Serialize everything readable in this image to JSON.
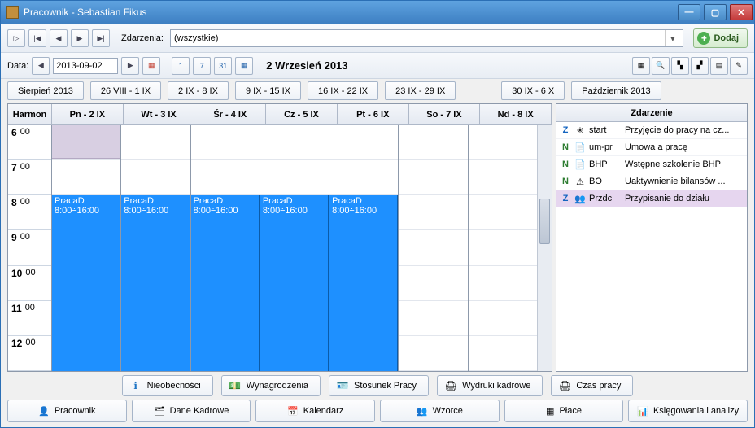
{
  "window": {
    "title": "Pracownik - Sebastian Fikus"
  },
  "toolbar": {
    "events_label": "Zdarzenia:",
    "events_value": "(wszystkie)",
    "add_label": "Dodaj",
    "date_label": "Data:",
    "date_value": "2013-09-02",
    "date_title": "2 Wrzesień 2013"
  },
  "nav_tabs": {
    "prev_month": "Sierpień 2013",
    "w1": "26 VIII - 1 IX",
    "w2": "2 IX - 8 IX",
    "w3": "9 IX - 15 IX",
    "w4": "16 IX - 22 IX",
    "w5": "23 IX - 29 IX",
    "w6": "30 IX - 6 X",
    "next_month": "Październik 2013"
  },
  "calendar": {
    "harmon_label": "Harmon",
    "days": [
      "Pn - 2 IX",
      "Wt - 3 IX",
      "Śr - 4 IX",
      "Cz - 5 IX",
      "Pt - 6 IX",
      "So - 7 IX",
      "Nd - 8 IX"
    ],
    "hours": [
      {
        "h": "6",
        "m": "00"
      },
      {
        "h": "7",
        "m": "00"
      },
      {
        "h": "8",
        "m": "00"
      },
      {
        "h": "9",
        "m": "00"
      },
      {
        "h": "10",
        "m": "00"
      },
      {
        "h": "11",
        "m": "00"
      },
      {
        "h": "12",
        "m": "00"
      }
    ],
    "event_title": "PracaD",
    "event_time": "8:00÷16:00"
  },
  "side": {
    "header": "Zdarzenie",
    "rows": [
      {
        "flag": "Z",
        "flagClass": "flag-Z",
        "ico": "✳",
        "code": "start",
        "desc": "Przyjęcie do pracy na cz..."
      },
      {
        "flag": "N",
        "flagClass": "flag-N",
        "ico": "📄",
        "code": "um-pr",
        "desc": "Umowa a pracę"
      },
      {
        "flag": "N",
        "flagClass": "flag-N",
        "ico": "📄",
        "code": "BHP",
        "desc": "Wstępne szkolenie BHP"
      },
      {
        "flag": "N",
        "flagClass": "flag-N",
        "ico": "⚠",
        "code": "BO",
        "desc": "Uaktywnienie bilansów ..."
      },
      {
        "flag": "Z",
        "flagClass": "flag-Z",
        "ico": "👥",
        "code": "Przdc",
        "desc": "Przypisanie do działu"
      }
    ]
  },
  "mid_buttons": {
    "b1": "Nieobecności",
    "b2": "Wynagrodzenia",
    "b3": "Stosunek Pracy",
    "b4": "Wydruki kadrowe",
    "b5": "Czas pracy"
  },
  "main_tabs": {
    "t1": "Pracownik",
    "t2": "Dane Kadrowe",
    "t3": "Kalendarz",
    "t4": "Wzorce",
    "t5": "Płace",
    "t6": "Księgowania i analizy"
  }
}
